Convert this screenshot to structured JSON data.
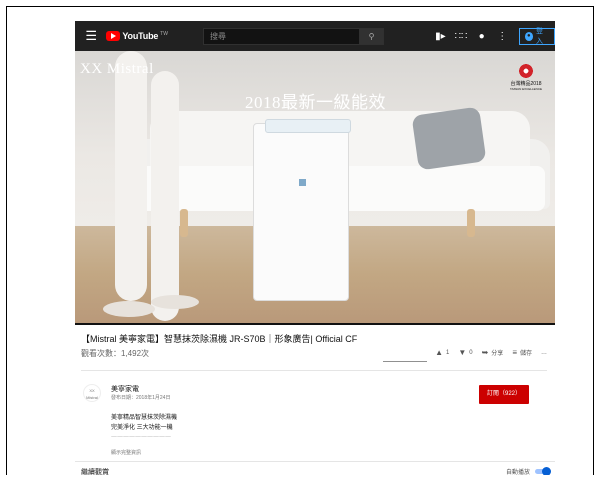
{
  "header": {
    "menu_icon": "hamburger-icon",
    "logo_text": "YouTube",
    "logo_region": "TW",
    "search_placeholder": "搜尋",
    "search_icon": "search-icon",
    "icons": [
      "create-video-icon",
      "apps-grid-icon",
      "messages-icon",
      "more-vertical-icon"
    ],
    "signin_label": "登入"
  },
  "video": {
    "brand": "Mistral",
    "headline": "2018最新一級能效",
    "award_line1": "台灣精品2018",
    "award_line2": "TAIWAN EXCELLENCE"
  },
  "info": {
    "title": "【Mistral 美寧家電】智慧抹茨除濕機 JR-S70B｜形象廣告| Official CF",
    "views": "觀看次數：1,492次",
    "like_count": "1",
    "dislike_count": "0",
    "share_label": "分享",
    "save_label": "儲存",
    "more_label": "…",
    "like_ratio": 1.0
  },
  "channel": {
    "name": "美寧家電",
    "publish_date": "發布日期：2018年1月24日",
    "subscribe_label": "訂閱（922）",
    "avatar_text": "Mistral",
    "description": [
      "美寧精品智慧抹茨除濕機",
      "完美淨化 三大功能一機",
      "一一一一一一一一一一"
    ],
    "show_more": "顯示完整資訊"
  },
  "up_next": {
    "label": "繼續觀賞",
    "autoplay_label": "自動播放",
    "autoplay_on": true
  },
  "colors": {
    "youtube_red": "#ff0000",
    "subscribe_red": "#cc0000",
    "signin_blue": "#3ea6ff",
    "toggle_blue": "#065fd4"
  }
}
